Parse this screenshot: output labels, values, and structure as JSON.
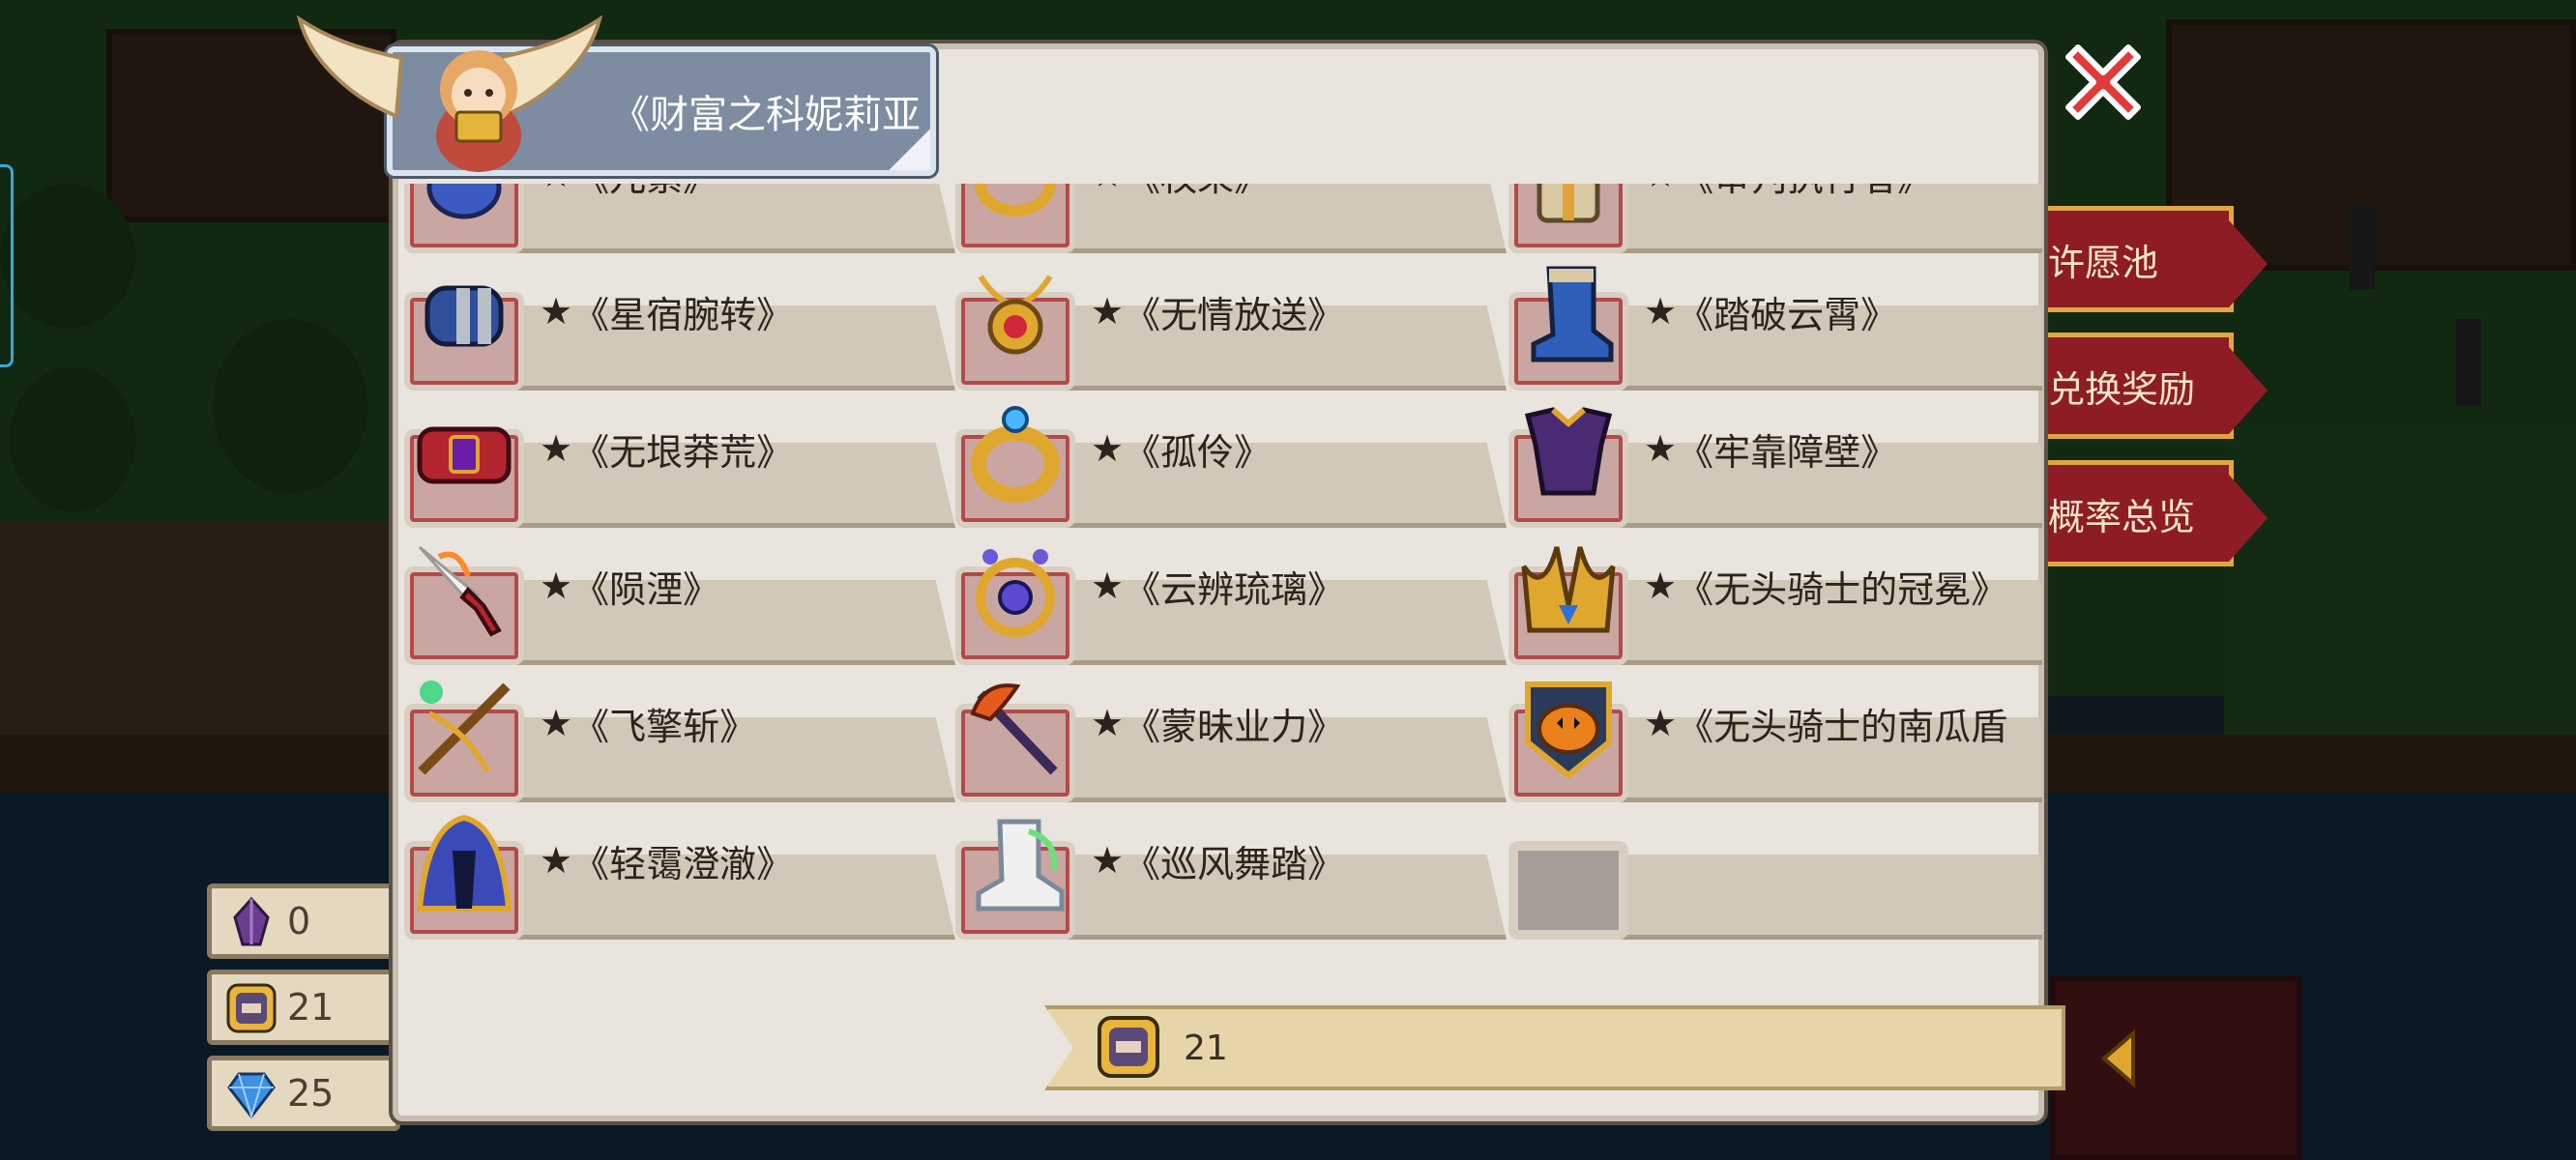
{
  "header": {
    "title": "《财富之科妮莉亚",
    "character_icon": "winged-angel-avatar"
  },
  "close_button": {
    "icon": "close-x-icon",
    "color": "#e03a3a"
  },
  "side_menu": {
    "items": [
      {
        "label": "许愿池"
      },
      {
        "label": "兑换奖励"
      },
      {
        "label": "概率总览"
      }
    ]
  },
  "currencies": [
    {
      "icon": "crystal-icon",
      "value": "0"
    },
    {
      "icon": "token-icon",
      "value": "21"
    },
    {
      "icon": "diamond-icon",
      "value": "25"
    }
  ],
  "items": [
    {
      "star": "★",
      "name": "《兀紫》",
      "icon": "blue-gauntlet-icon"
    },
    {
      "star": "★",
      "name": "《权荣》",
      "icon": "gold-ring-icon"
    },
    {
      "star": "★",
      "name": "《审判执行者》",
      "icon": "gold-armor-icon"
    },
    {
      "star": "★",
      "name": "《星宿腕转》",
      "icon": "blue-bracer-icon"
    },
    {
      "star": "★",
      "name": "《无情放送》",
      "icon": "ruby-necklace-icon"
    },
    {
      "star": "★",
      "name": "《踏破云霄》",
      "icon": "blue-boot-icon"
    },
    {
      "star": "★",
      "name": "《无垠莽荒》",
      "icon": "red-belt-icon"
    },
    {
      "star": "★",
      "name": "《孤伶》",
      "icon": "gold-sapphire-ring-icon"
    },
    {
      "star": "★",
      "name": "《牢靠障壁》",
      "icon": "purple-chestplate-icon"
    },
    {
      "star": "★",
      "name": "《陨湮》",
      "icon": "flame-sword-icon"
    },
    {
      "star": "★",
      "name": "《云辨琉璃》",
      "icon": "orb-amulet-icon"
    },
    {
      "star": "★",
      "name": "《无头骑士的冠冕》",
      "icon": "horned-crown-icon"
    },
    {
      "star": "★",
      "name": "《飞擎斩》",
      "icon": "jade-crossbow-icon"
    },
    {
      "star": "★",
      "name": "《蒙昧业力》",
      "icon": "fire-staff-icon"
    },
    {
      "star": "★",
      "name": "《无头骑士的南瓜盾",
      "icon": "pumpkin-shield-icon"
    },
    {
      "star": "★",
      "name": "《轻霭澄澈》",
      "icon": "blue-cloak-icon"
    },
    {
      "star": "★",
      "name": "《巡风舞踏》",
      "icon": "wind-boot-icon"
    },
    {
      "star": "",
      "name": "",
      "icon": "empty-slot"
    }
  ],
  "footer": {
    "currency_icon": "token-icon",
    "currency_value": "21"
  }
}
